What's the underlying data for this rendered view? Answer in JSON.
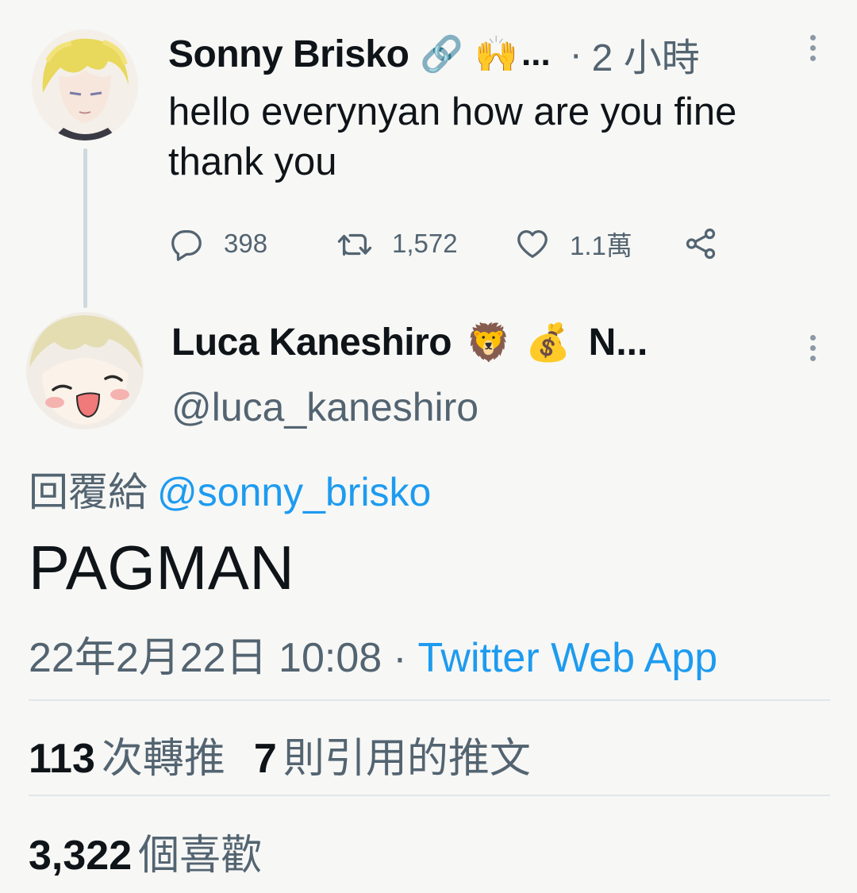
{
  "parent_tweet": {
    "author_name": "Sonny Brisko",
    "badge_emojis": [
      "🔗",
      "🙌"
    ],
    "name_ellipsis": "...",
    "separator": "·",
    "time_ago": "2 小時",
    "text": "hello everynyan how are you fine thank you",
    "actions": {
      "replies": "398",
      "retweets": "1,572",
      "likes": "1.1萬"
    },
    "icons": [
      "reply-icon",
      "retweet-icon",
      "like-icon",
      "share-icon",
      "more-icon"
    ]
  },
  "main_tweet": {
    "author_name": "Luca Kaneshiro",
    "badge_emojis": [
      "🦁",
      "💰"
    ],
    "name_suffix": "N...",
    "handle": "@luca_kaneshiro",
    "reply_prefix": "回覆給",
    "reply_to": "@sonny_brisko",
    "text": "PAGMAN",
    "timestamp": "22年2月22日 10:08",
    "separator": "·",
    "source": "Twitter Web App"
  },
  "stats": {
    "retweet_count": "113",
    "retweet_label": "次轉推",
    "quote_count": "7",
    "quote_label": "則引用的推文",
    "like_count": "3,322",
    "like_label": "個喜歡"
  },
  "colors": {
    "background": "#f7f7f5",
    "text": "#0f1419",
    "secondary": "#536471",
    "link": "#1d9bf0",
    "thread_line": "#cfd9de"
  }
}
